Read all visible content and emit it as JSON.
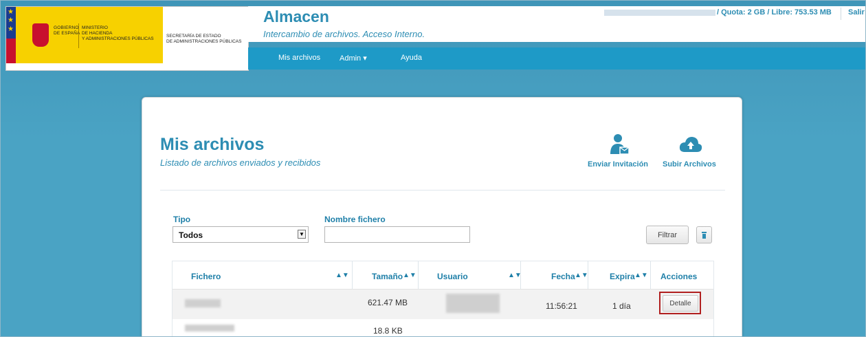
{
  "header": {
    "gov": [
      "GOBIERNO",
      "DE ESPAÑA"
    ],
    "ministry": [
      "MINISTERIO",
      "DE HACIENDA",
      "Y ADMINISTRACIONES PÚBLICAS"
    ],
    "secretariat": [
      "SECRETARÍA DE ESTADO",
      "DE ADMINISTRACIONES PÚBLICAS"
    ],
    "app_title": "Almacen",
    "app_subtitle": "Intercambio de archivos. Acceso Interno.",
    "quota": "/ Quota: 2 GB / Libre: 753.53 MB",
    "logout": "Salir"
  },
  "nav": {
    "mis_archivos": "Mis archivos",
    "admin": "Admin",
    "ayuda": "Ayuda"
  },
  "page": {
    "title": "Mis archivos",
    "subtitle": "Listado de archivos enviados y recibidos",
    "invite": "Enviar Invitación",
    "upload": "Subir Archivos"
  },
  "filters": {
    "tipo_label": "Tipo",
    "tipo_value": "Todos",
    "nombre_label": "Nombre fichero",
    "nombre_value": "",
    "filtrar": "Filtrar"
  },
  "table": {
    "headers": [
      "Fichero",
      "Tamaño",
      "Usuario",
      "Fecha",
      "Expira",
      "Acciones"
    ],
    "rows": [
      {
        "size": "621.47 MB",
        "date": "11:56:21",
        "expires": "1 día",
        "action": "Detalle"
      },
      {
        "size": "18.8 KB"
      }
    ]
  },
  "colors": {
    "accent": "#2d8db3",
    "nav": "#1e9ac7",
    "background": "#4aa3c4",
    "highlight": "#b11f1f"
  }
}
